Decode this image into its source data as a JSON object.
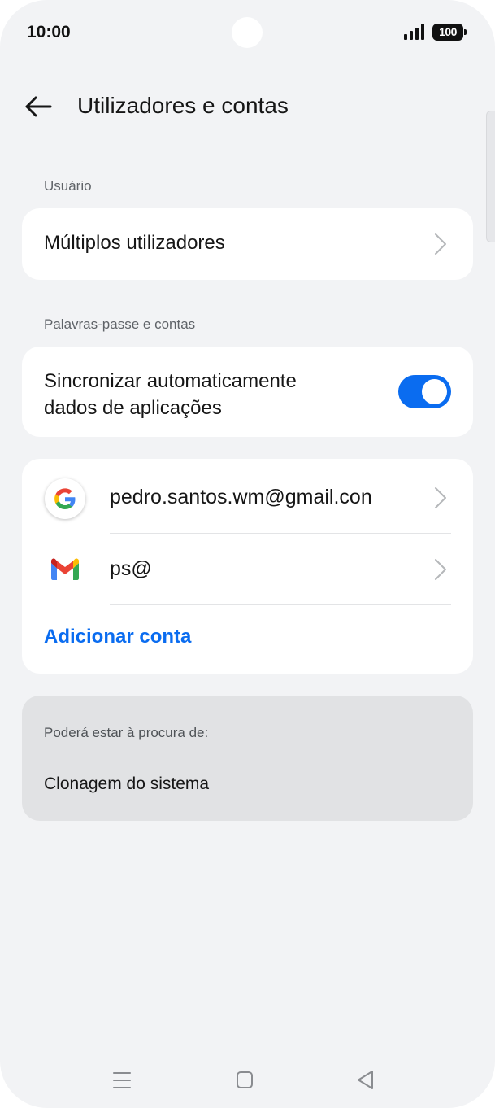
{
  "status_bar": {
    "time": "10:00",
    "battery": "100"
  },
  "header": {
    "title": "Utilizadores e contas"
  },
  "user_section": {
    "label": "Usuário",
    "multiple_users_label": "Múltiplos utilizadores"
  },
  "passwords_section": {
    "label": "Palavras-passe e contas",
    "auto_sync_line1": "Sincronizar automaticamente",
    "auto_sync_line2": "dados de aplicações",
    "auto_sync_enabled": true
  },
  "accounts": [
    {
      "icon": "google-icon",
      "email": "pedro.santos.wm@gmail.con"
    },
    {
      "icon": "gmail-icon",
      "email": "ps@"
    }
  ],
  "add_account_label": "Adicionar conta",
  "suggestions": {
    "label": "Poderá estar à procura de:",
    "item": "Clonagem do sistema"
  },
  "colors": {
    "accent": "#0a6cf0",
    "background": "#f2f3f5",
    "card": "#ffffff"
  }
}
